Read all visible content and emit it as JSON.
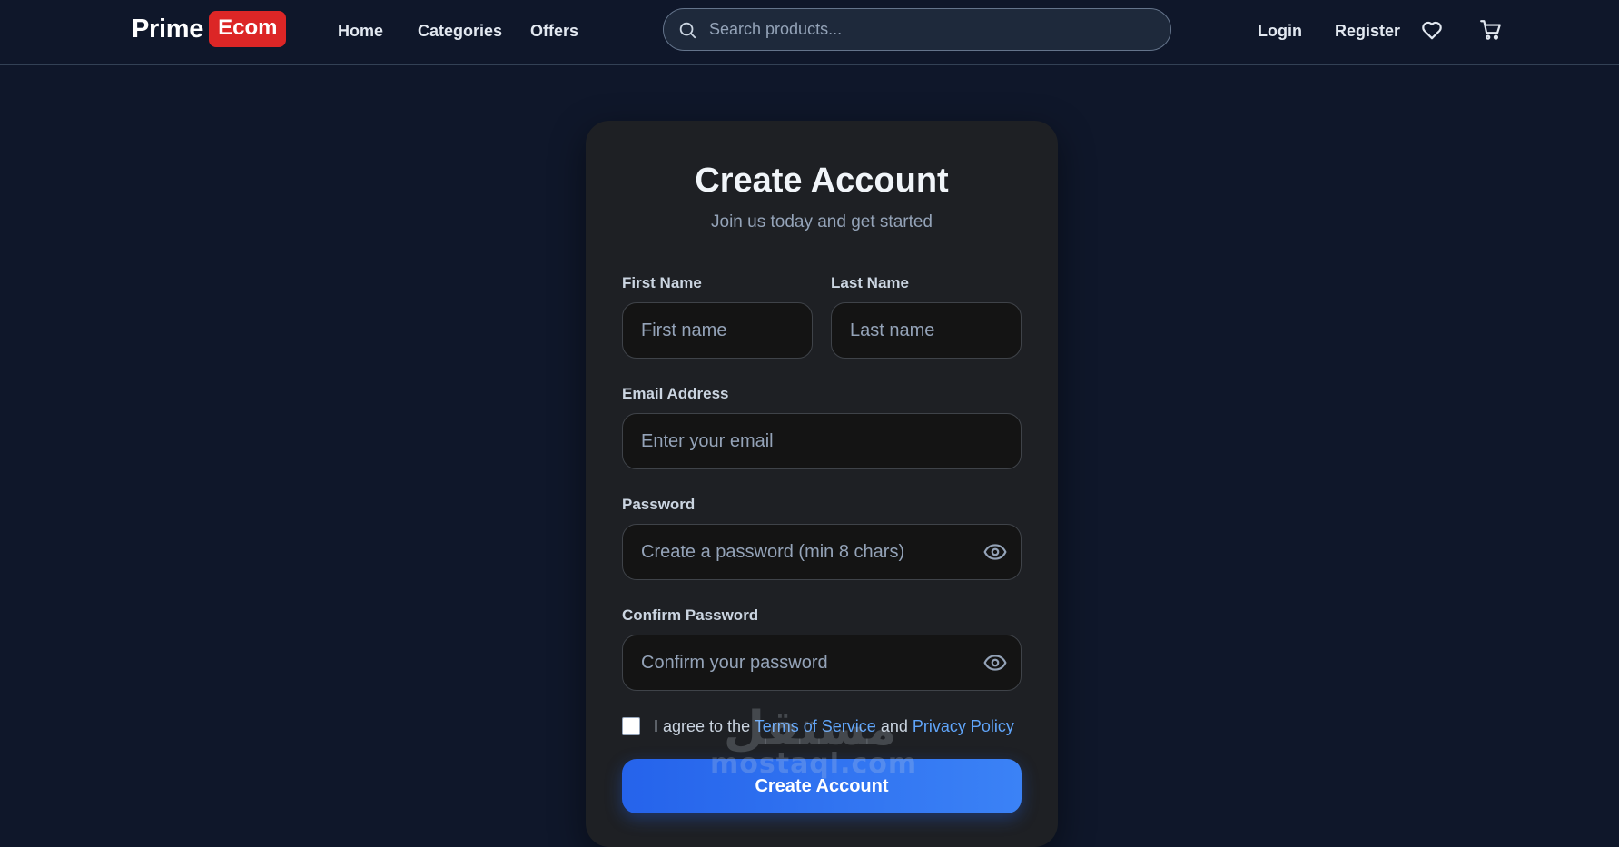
{
  "brand": {
    "name_part1": "Prime",
    "name_part2": "Ecom",
    "accent_color": "#dc2626"
  },
  "nav": {
    "links": [
      {
        "label": "Home"
      },
      {
        "label": "Categories"
      },
      {
        "label": "Offers"
      }
    ],
    "search_placeholder": "Search products...",
    "login_label": "Login",
    "register_label": "Register",
    "icons": [
      "search-icon",
      "heart-icon",
      "cart-icon"
    ]
  },
  "form": {
    "title": "Create Account",
    "subtitle": "Join us today and get started",
    "first_name": {
      "label": "First Name",
      "placeholder": "First name",
      "value": ""
    },
    "last_name": {
      "label": "Last Name",
      "placeholder": "Last name",
      "value": ""
    },
    "email": {
      "label": "Email Address",
      "placeholder": "Enter your email",
      "value": ""
    },
    "password": {
      "label": "Password",
      "placeholder": "Create a password (min 8 chars)",
      "value": ""
    },
    "confirm_password": {
      "label": "Confirm Password",
      "placeholder": "Confirm your password",
      "value": ""
    },
    "terms": {
      "checked": false,
      "prefix": "I agree to the",
      "terms_link": "Terms of Service",
      "conjunction": "and",
      "privacy_link": "Privacy Policy"
    },
    "submit_label": "Create Account",
    "button_color": "#2563eb",
    "link_color": "#60a5fa"
  },
  "watermark": {
    "arabic": "مستقل",
    "latin": "mostaql.com"
  }
}
